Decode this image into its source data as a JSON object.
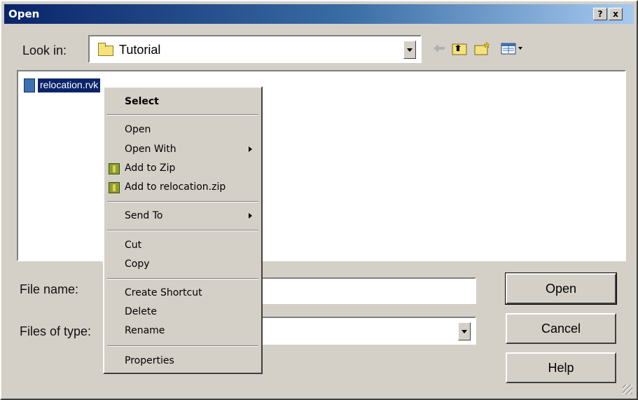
{
  "window": {
    "title": "Open",
    "help_btn": "?",
    "close_btn": "x"
  },
  "look_in": {
    "label": "Look in:",
    "value": "Tutorial"
  },
  "file_list": {
    "items": [
      {
        "name": "relocation.rvk"
      }
    ]
  },
  "context_menu": {
    "items": {
      "select": "Select",
      "open": "Open",
      "open_with": "Open With",
      "add_to_zip": "Add to Zip",
      "add_to_relocation_zip": "Add to relocation.zip",
      "send_to": "Send To",
      "cut": "Cut",
      "copy": "Copy",
      "create_shortcut": "Create Shortcut",
      "delete": "Delete",
      "rename": "Rename",
      "properties": "Properties"
    }
  },
  "form": {
    "file_name_label": "File name:",
    "file_name_value": "",
    "files_of_type_label": "Files of type:",
    "files_of_type_value": ""
  },
  "buttons": {
    "open": "Open",
    "cancel": "Cancel",
    "help": "Help"
  },
  "icons": {
    "back": "back-arrow-icon",
    "up_folder": "up-folder-icon",
    "new_folder": "new-folder-icon",
    "view_menu": "view-menu-icon",
    "folder": "folder-icon",
    "file": "file-icon",
    "zip": "zip-icon"
  },
  "colors": {
    "title_start": "#0a246a",
    "title_end": "#a6caf0",
    "selection": "#0a246a",
    "face": "#d4d0c8"
  }
}
